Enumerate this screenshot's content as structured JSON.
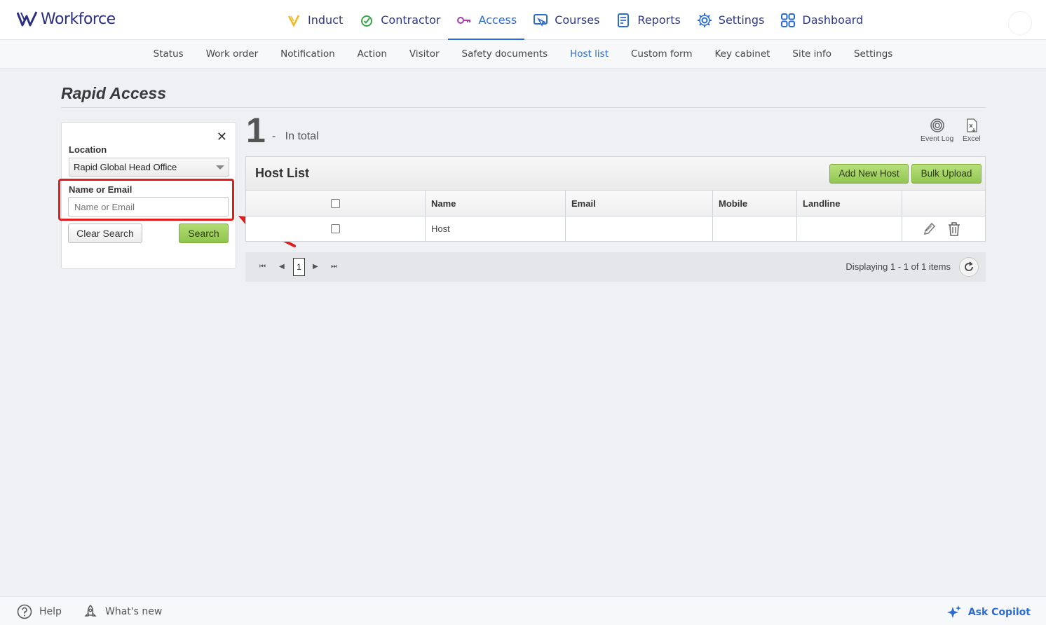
{
  "app": {
    "brand": "Workforce"
  },
  "mainnav": [
    {
      "label": "Induct",
      "icon": "induct-icon",
      "active": false
    },
    {
      "label": "Contractor",
      "icon": "contractor-icon",
      "active": false
    },
    {
      "label": "Access",
      "icon": "access-key-icon",
      "active": true
    },
    {
      "label": "Courses",
      "icon": "courses-icon",
      "active": false
    },
    {
      "label": "Reports",
      "icon": "reports-icon",
      "active": false
    },
    {
      "label": "Settings",
      "icon": "gear-icon",
      "active": false
    },
    {
      "label": "Dashboard",
      "icon": "dashboard-grid-icon",
      "active": false
    }
  ],
  "subnav": [
    "Status",
    "Work order",
    "Notification",
    "Action",
    "Visitor",
    "Safety documents",
    "Host list",
    "Custom form",
    "Key cabinet",
    "Site info",
    "Settings"
  ],
  "subnav_active": "Host list",
  "page": {
    "title": "Rapid Access"
  },
  "filter": {
    "location_label": "Location",
    "location_value": "Rapid Global Head Office",
    "name_label": "Name or Email",
    "name_placeholder": "Name or Email",
    "clear_label": "Clear Search",
    "search_label": "Search"
  },
  "summary": {
    "count": "1",
    "dash": "-",
    "total_label": "In total"
  },
  "tools": {
    "event_log": "Event Log",
    "excel": "Excel"
  },
  "grid": {
    "title": "Host List",
    "add_label": "Add New Host",
    "bulk_label": "Bulk Upload",
    "columns": [
      "Name",
      "Email",
      "Mobile",
      "Landline"
    ],
    "rows": [
      {
        "name": "Host",
        "email": "",
        "mobile": "",
        "landline": ""
      }
    ]
  },
  "pager": {
    "page": "1",
    "info": "Displaying 1 - 1 of 1 items"
  },
  "footer": {
    "help": "Help",
    "whats_new": "What's new",
    "copilot": "Ask Copilot"
  },
  "colors": {
    "accent": "#2b6bd6",
    "brand": "#2a2f7e",
    "button_green": "#8fc44f",
    "highlight": "#e01c1c"
  }
}
